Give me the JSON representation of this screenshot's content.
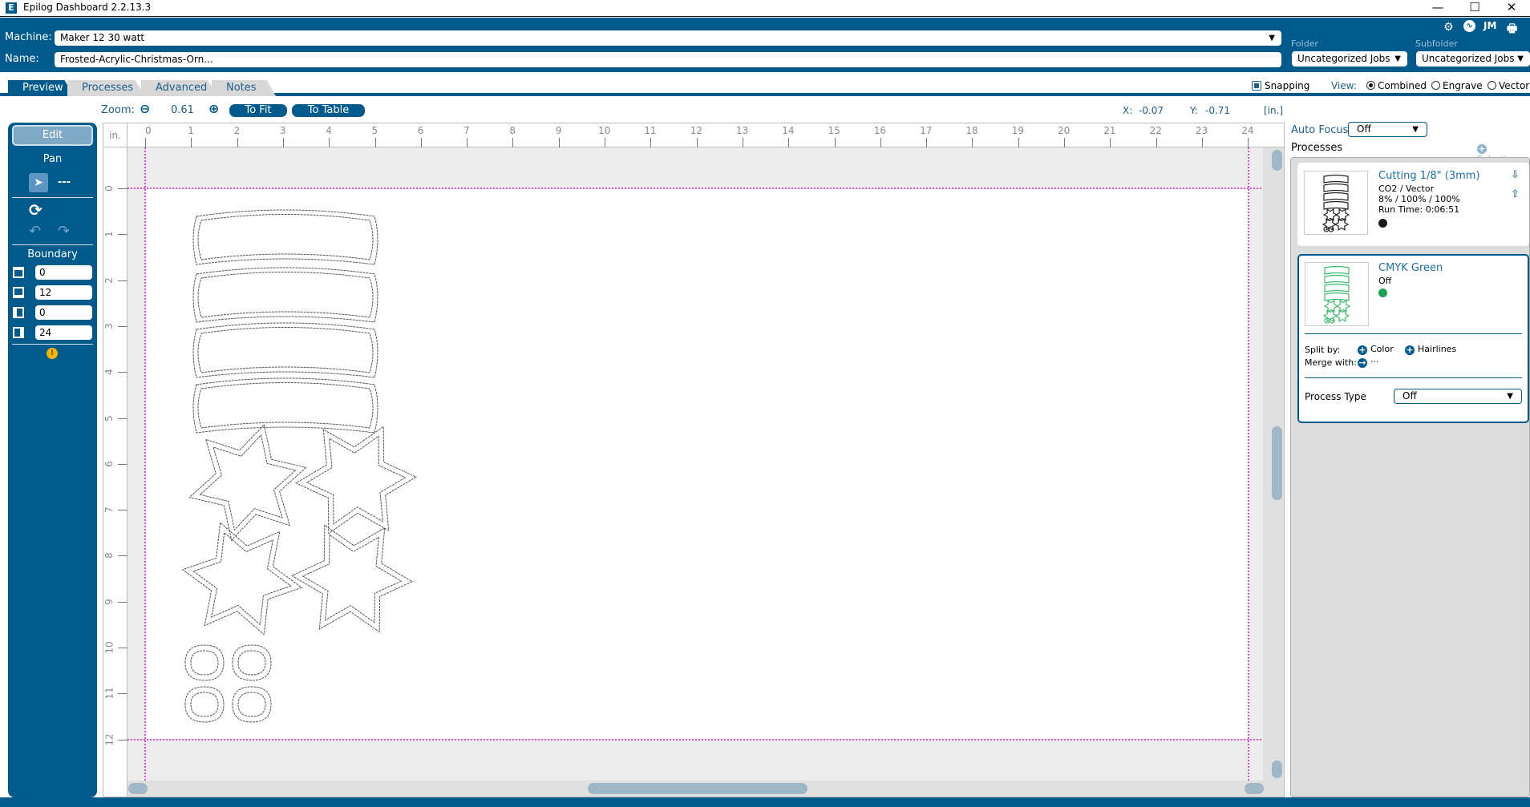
{
  "window": {
    "title": "Epilog Dashboard 2.2.13.3",
    "app_icon_glyph": "E",
    "controls": {
      "minimize": "—",
      "maximize": "☐",
      "close": "✕"
    }
  },
  "header": {
    "machine_label": "Machine:",
    "machine_value": "Maker 12 30 watt",
    "name_label": "Name:",
    "name_value": "Frosted-Acrylic-Christmas-Orn...",
    "folder_label": "Folder",
    "folder_value": "Uncategorized Jobs",
    "subfolder_label": "Subfolder",
    "subfolder_value": "Uncategorized Jobs",
    "icons": [
      "gear-icon",
      "activity-icon",
      "user-initials",
      "printer-icon"
    ],
    "user_initials": "JM",
    "dropdown_arrow": "▼"
  },
  "tabs": [
    {
      "label": "Preview",
      "active": true
    },
    {
      "label": "Processes",
      "active": false
    },
    {
      "label": "Advanced",
      "active": false
    },
    {
      "label": "Notes",
      "active": false
    }
  ],
  "view_options": {
    "snapping_label": "Snapping",
    "snapping_checked": true,
    "view_label": "View:",
    "modes": [
      {
        "label": "Combined",
        "selected": true
      },
      {
        "label": "Engrave",
        "selected": false
      },
      {
        "label": "Vector",
        "selected": false
      }
    ]
  },
  "zoom_bar": {
    "label": "Zoom:",
    "value": "0.61",
    "to_fit": "To Fit",
    "to_table": "To Table",
    "x_label": "X:",
    "x_value": "-0.07",
    "y_label": "Y:",
    "y_value": "-0.71",
    "units": "[in.]"
  },
  "tool_panel": {
    "edit_label": "Edit",
    "pan_label": "Pan",
    "pan_value": "---",
    "boundary_label": "Boundary",
    "boundary": {
      "top": "0",
      "bottom": "12",
      "left": "0",
      "right": "24"
    },
    "warning_glyph": "!"
  },
  "rulers": {
    "unit": "in.",
    "horizontal": [
      "0",
      "1",
      "2",
      "3",
      "4",
      "5",
      "6",
      "7",
      "8",
      "9",
      "10",
      "11",
      "12",
      "13",
      "14",
      "15",
      "16",
      "17",
      "18",
      "19",
      "20",
      "21",
      "22",
      "23",
      "24"
    ],
    "vertical": [
      "0",
      "1",
      "2",
      "3",
      "4",
      "5",
      "6",
      "7",
      "8",
      "9",
      "10",
      "11",
      "12"
    ]
  },
  "right_panel": {
    "auto_focus_label": "Auto Focus",
    "auto_focus_value": "Off",
    "processes_label": "Processes",
    "selection_label": "Selection",
    "processes": [
      {
        "name": "Cutting 1/8\" (3mm)",
        "type": "CO2 / Vector",
        "settings": "8% / 100% / 100%",
        "run_time": "Run Time: 0:06:51",
        "color": "#1a1a1a"
      },
      {
        "name": "CMYK Green",
        "type": "Off",
        "color": "#1aa352",
        "split_by_label": "Split by:",
        "split_color": "Color",
        "split_hairlines": "Hairlines",
        "merge_label": "Merge with:",
        "merge_value": "···",
        "process_type_label": "Process Type",
        "process_type_value": "Off"
      }
    ]
  },
  "colors": {
    "brand_blue": "#005A8C",
    "boundary_magenta": "#ee44ee",
    "link_blue": "#1c6fa8"
  }
}
